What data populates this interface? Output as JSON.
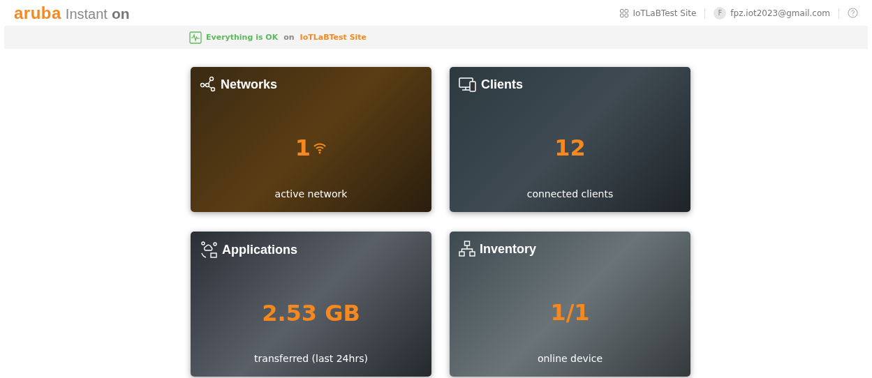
{
  "header": {
    "brand": "aruba",
    "product": "Instant",
    "product_suffix": "on",
    "site": "IoTLaBTest Site",
    "user_initial": "F",
    "user_email": "fpz.iot2023@gmail.com"
  },
  "status": {
    "message": "Everything is OK",
    "joiner": "on",
    "site": "IoTLaBTest Site"
  },
  "cards": [
    {
      "kind": "networks",
      "title": "Networks",
      "value": "1",
      "caption": "active network"
    },
    {
      "kind": "clients",
      "title": "Clients",
      "value": "12",
      "caption": "connected clients"
    },
    {
      "kind": "applications",
      "title": "Applications",
      "value": "2.53 GB",
      "caption": "transferred (last 24hrs)"
    },
    {
      "kind": "inventory",
      "title": "Inventory",
      "value": "1/1",
      "caption": "online device"
    }
  ]
}
